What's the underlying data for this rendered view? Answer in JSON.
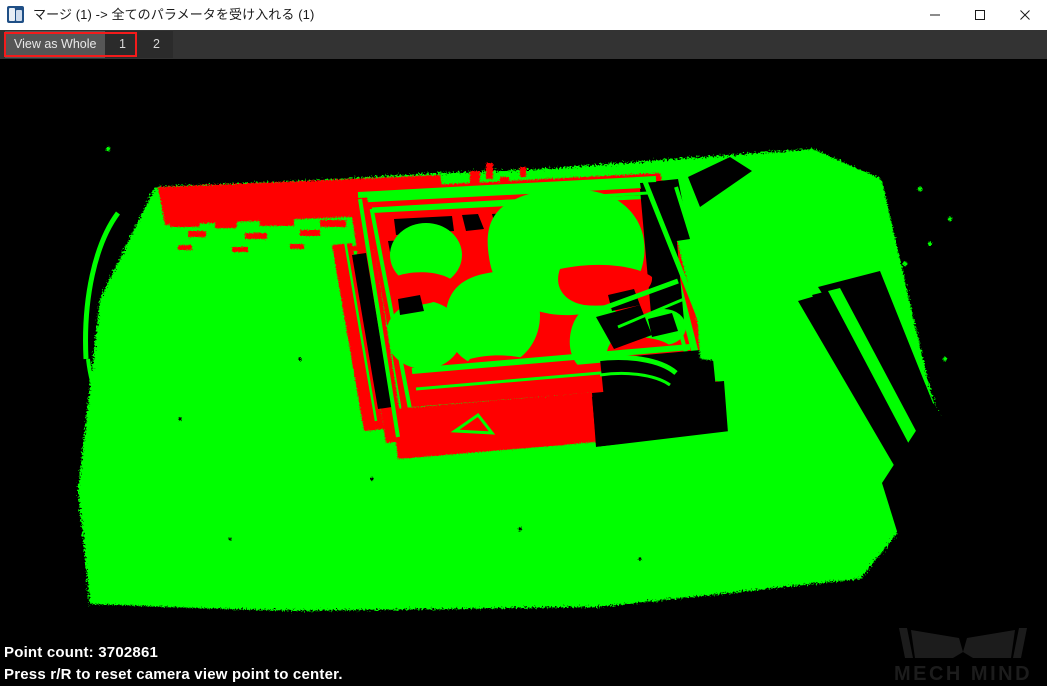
{
  "window": {
    "title": "マージ (1) -> 全てのパラメータを受け入れる (1)",
    "icon": "app-icon",
    "controls": {
      "minimize": "minimize-icon",
      "maximize": "maximize-icon",
      "close": "close-icon"
    }
  },
  "toolbar": {
    "view_as_whole_label": "View as Whole",
    "cloud_1_label": "1",
    "cloud_2_label": "2",
    "highlight_color": "#f51b1b",
    "background_color": "#333333"
  },
  "viewport": {
    "background_color": "#000000",
    "cloud_colors": {
      "cloud_1": "#00ff00",
      "cloud_2": "#ff0000"
    }
  },
  "status": {
    "point_count_label": "Point count: 3702861",
    "hint_label": "Press r/R to reset camera view point to center."
  },
  "watermark": {
    "text": "MECH MIND",
    "color": "#1c1c1c"
  }
}
